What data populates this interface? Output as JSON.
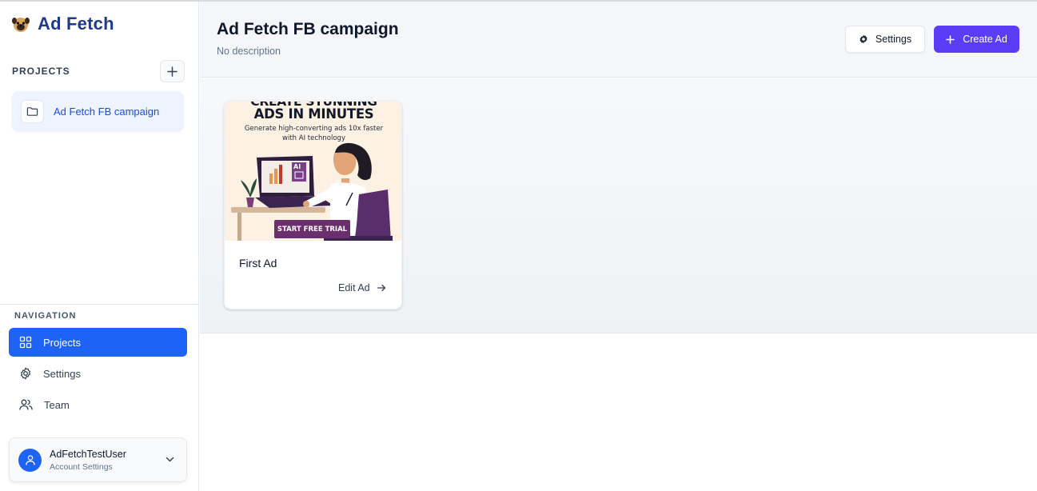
{
  "app": {
    "name": "Ad Fetch",
    "logo_icon": "pug-logo-icon"
  },
  "sidebar": {
    "projects_label": "PROJECTS",
    "projects": [
      {
        "label": "Ad Fetch FB campaign",
        "icon": "folder-icon",
        "selected": true
      }
    ],
    "navigation_label": "NAVIGATION",
    "nav_items": [
      {
        "label": "Projects",
        "icon": "grid-icon",
        "active": true
      },
      {
        "label": "Settings",
        "icon": "gear-icon",
        "active": false
      },
      {
        "label": "Team",
        "icon": "users-icon",
        "active": false
      }
    ],
    "user": {
      "name": "AdFetchTestUser",
      "subtitle": "Account Settings"
    }
  },
  "header": {
    "title": "Ad Fetch FB campaign",
    "description": "No description",
    "settings_label": "Settings",
    "create_label": "Create Ad"
  },
  "ads": [
    {
      "title": "First Ad",
      "edit_label": "Edit Ad",
      "image": {
        "headline_1": "CREATE STUNNING",
        "headline_2": "ADS IN MINUTES",
        "subline_1": "Generate high-converting ads 10x faster",
        "subline_2": "with AI technology",
        "badge": "AI",
        "cta": "START FREE TRIAL"
      }
    }
  ],
  "colors": {
    "primary": "#1d63f5",
    "create_button": "#5b3df5",
    "brand_text": "#1e3a8a",
    "ad_cta": "#6b2f6e"
  }
}
